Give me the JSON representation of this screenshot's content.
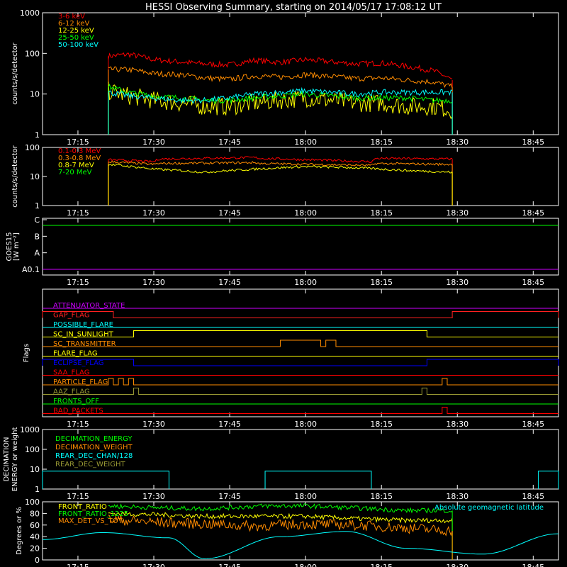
{
  "title": "HESSI Observing Summary, starting on 2014/05/17 17:08:12 UT",
  "time_axis": {
    "start": "17:08",
    "end": "18:50",
    "ticks": [
      "17:15",
      "17:30",
      "17:45",
      "18:00",
      "18:15",
      "18:30",
      "18:45"
    ]
  },
  "chart_data": [
    {
      "type": "line",
      "id": "low_energy",
      "ylog": true,
      "ylim": [
        1,
        1000
      ],
      "ylabel": "counts/s/detector",
      "yticks": [
        "1",
        "10",
        "100",
        "1000"
      ],
      "data_start": "17:21",
      "data_end": "18:29",
      "series": [
        {
          "name": "3-6 keV",
          "color": "#ff0000",
          "x": [
            "17:21",
            "17:25",
            "17:30",
            "17:35",
            "17:40",
            "17:45",
            "17:50",
            "17:55",
            "18:00",
            "18:05",
            "18:10",
            "18:15",
            "18:20",
            "18:25",
            "18:29"
          ],
          "values": [
            85,
            95,
            70,
            62,
            55,
            52,
            68,
            60,
            70,
            62,
            55,
            58,
            48,
            38,
            22
          ]
        },
        {
          "name": "6-12 keV",
          "color": "#ff8c00",
          "x": [
            "17:21",
            "17:25",
            "17:30",
            "17:35",
            "17:40",
            "17:45",
            "17:50",
            "17:55",
            "18:00",
            "18:05",
            "18:10",
            "18:15",
            "18:20",
            "18:25",
            "18:29"
          ],
          "values": [
            40,
            40,
            32,
            30,
            25,
            23,
            28,
            26,
            30,
            27,
            24,
            25,
            22,
            20,
            15
          ]
        },
        {
          "name": "12-25 keV",
          "color": "#ffff00",
          "x": [
            "17:21",
            "17:25",
            "17:30",
            "17:35",
            "17:40",
            "17:45",
            "17:50",
            "17:55",
            "18:00",
            "18:05",
            "18:10",
            "18:15",
            "18:20",
            "18:25",
            "18:29"
          ],
          "values": [
            12,
            9,
            7,
            6,
            5,
            5,
            6,
            7,
            8,
            7,
            6,
            6,
            5,
            5,
            4
          ]
        },
        {
          "name": "25-50 keV",
          "color": "#00ff00",
          "x": [
            "17:21",
            "17:25",
            "17:30",
            "17:35",
            "17:40",
            "17:45",
            "17:50",
            "17:55",
            "18:00",
            "18:05",
            "18:10",
            "18:15",
            "18:20",
            "18:25",
            "18:29"
          ],
          "values": [
            15,
            11,
            9,
            8,
            7,
            7,
            8,
            9,
            10,
            9,
            8,
            8,
            8,
            7,
            7
          ]
        },
        {
          "name": "50-100 keV",
          "color": "#00ffff",
          "x": [
            "17:21",
            "17:25",
            "17:30",
            "17:35",
            "17:40",
            "17:45",
            "17:50",
            "17:55",
            "18:00",
            "18:05",
            "18:10",
            "18:15",
            "18:20",
            "18:25",
            "18:29"
          ],
          "values": [
            11,
            9,
            8,
            7,
            7,
            8,
            10,
            11,
            12,
            11,
            10,
            11,
            11,
            11,
            11
          ]
        }
      ]
    },
    {
      "type": "line",
      "id": "high_energy",
      "ylog": true,
      "ylim": [
        1,
        100
      ],
      "ylabel": "counts/s/detector",
      "yticks": [
        "1",
        "10",
        "100"
      ],
      "series": [
        {
          "name": "0.1-0.3 MeV",
          "color": "#ff0000",
          "x": [
            "17:21",
            "17:30",
            "17:31",
            "17:50",
            "17:51",
            "18:13",
            "18:14",
            "18:29"
          ],
          "values": [
            38,
            32,
            40,
            45,
            42,
            32,
            42,
            40
          ]
        },
        {
          "name": "0.3-0.8 MeV",
          "color": "#ff8c00",
          "x": [
            "17:21",
            "17:30",
            "17:31",
            "17:50",
            "17:51",
            "18:13",
            "18:14",
            "18:29"
          ],
          "values": [
            32,
            26,
            28,
            30,
            28,
            24,
            28,
            26
          ]
        },
        {
          "name": "0.8-7 MeV",
          "color": "#ffff00",
          "x": [
            "17:21",
            "17:30",
            "17:40",
            "17:50",
            "18:00",
            "18:10",
            "18:20",
            "18:29"
          ],
          "values": [
            26,
            18,
            14,
            18,
            22,
            20,
            16,
            14
          ]
        },
        {
          "name": "7-20 MeV",
          "color": "#00ff00",
          "x": [],
          "values": []
        }
      ]
    },
    {
      "type": "line",
      "id": "goes",
      "ylabel": "GOES15",
      "ylabel2": "[W m⁻²]",
      "yticks": [
        "A0.1",
        "A",
        "B",
        "C"
      ],
      "series": [
        {
          "name": "GOES15",
          "color": "#00ff00",
          "level": "C"
        },
        {
          "name": "",
          "color": "#cc00ff",
          "level": "A0.1"
        }
      ]
    },
    {
      "type": "flags",
      "id": "flags",
      "ylabel": "Flags",
      "flags": [
        {
          "name": "ATTENUATOR_STATE",
          "color": "#cc00ff",
          "segments": []
        },
        {
          "name": "GAP_FLAG",
          "color": "#ff2020",
          "segments": [
            [
              "17:08",
              "17:22"
            ],
            [
              "18:29",
              "18:50"
            ]
          ]
        },
        {
          "name": "POSSIBLE_FLARE",
          "color": "#00ffff",
          "segments": []
        },
        {
          "name": "SC_IN_SUNLIGHT",
          "color": "#ffff00",
          "segments": [
            [
              "17:26",
              "18:24"
            ]
          ]
        },
        {
          "name": "SC_TRANSMITTER",
          "color": "#ff8c00",
          "segments": [
            [
              "17:55",
              "18:03"
            ],
            [
              "18:04",
              "18:06"
            ]
          ]
        },
        {
          "name": "FLARE_FLAG",
          "color": "#ffff00",
          "segments": []
        },
        {
          "name": "ECLIPSE_FLAG",
          "color": "#0000ff",
          "segments": [
            [
              "17:08",
              "17:26"
            ],
            [
              "18:24",
              "18:50"
            ]
          ]
        },
        {
          "name": "SAA_FLAG",
          "color": "#ff0000",
          "segments": []
        },
        {
          "name": "PARTICLE_FLAG",
          "color": "#ff8c00",
          "segments": [
            [
              "17:21",
              "17:22"
            ],
            [
              "17:23",
              "17:24"
            ],
            [
              "17:25",
              "17:26"
            ],
            [
              "18:27",
              "18:28"
            ]
          ]
        },
        {
          "name": "AAZ_FLAG",
          "color": "#999933",
          "segments": [
            [
              "17:26",
              "17:27"
            ],
            [
              "18:23",
              "18:24"
            ]
          ]
        },
        {
          "name": "FRONTS_OFF",
          "color": "#00ff00",
          "segments": []
        },
        {
          "name": "BAD_PACKETS",
          "color": "#ff0000",
          "segments": [
            [
              "18:27",
              "18:28"
            ]
          ]
        }
      ]
    },
    {
      "type": "line",
      "id": "decimation",
      "ylog": true,
      "ylim": [
        1,
        1000
      ],
      "ylabel": "DECIMATION",
      "ylabel2": "ENERGY or weight",
      "yticks": [
        "1",
        "10",
        "100",
        "1000"
      ],
      "series": [
        {
          "name": "DECIMATION_ENERGY",
          "color": "#00ff00"
        },
        {
          "name": "DECIMATION_WEIGHT",
          "color": "#ff8c00"
        },
        {
          "name": "REAR_DEC_CHAN/128",
          "color": "#00ffff",
          "segments": [
            [
              "17:08",
              "17:33"
            ],
            [
              "17:52",
              "18:13"
            ],
            [
              "18:46",
              "18:50"
            ]
          ],
          "level": 8
        },
        {
          "name": "REAR_DEC_WEIGHT",
          "color": "#999933"
        }
      ]
    },
    {
      "type": "line",
      "id": "ratios",
      "ylim": [
        0,
        100
      ],
      "ylabel": "Degrees or %",
      "yticks": [
        "0",
        "20",
        "40",
        "60",
        "80",
        "100"
      ],
      "series": [
        {
          "name": "FRONT_RATIO",
          "color": "#ffff00",
          "x": [
            "17:21",
            "17:30",
            "17:40",
            "17:52",
            "18:00",
            "18:13",
            "18:20",
            "18:29"
          ],
          "values": [
            80,
            78,
            75,
            75,
            75,
            70,
            68,
            68
          ]
        },
        {
          "name": "FRONT_RATIO_1225",
          "color": "#00ff00",
          "x": [
            "17:21",
            "17:30",
            "17:40",
            "17:52",
            "18:00",
            "18:13",
            "18:20",
            "18:29"
          ],
          "values": [
            93,
            90,
            88,
            93,
            93,
            88,
            85,
            85
          ]
        },
        {
          "name": "MAX_DET_VS_TOT",
          "color": "#ff8c00",
          "x": [
            "17:21",
            "17:30",
            "17:40",
            "17:50",
            "18:00",
            "18:10",
            "18:20",
            "18:29"
          ],
          "values": [
            70,
            65,
            62,
            58,
            62,
            60,
            55,
            50
          ]
        },
        {
          "name": "Absolute geomagnetic latitude",
          "color": "#00ffff",
          "x": [
            "17:08",
            "17:20",
            "17:33",
            "17:40",
            "17:55",
            "18:08",
            "18:20",
            "18:35",
            "18:50"
          ],
          "values": [
            35,
            47,
            38,
            2,
            40,
            49,
            20,
            10,
            45
          ]
        }
      ]
    }
  ]
}
